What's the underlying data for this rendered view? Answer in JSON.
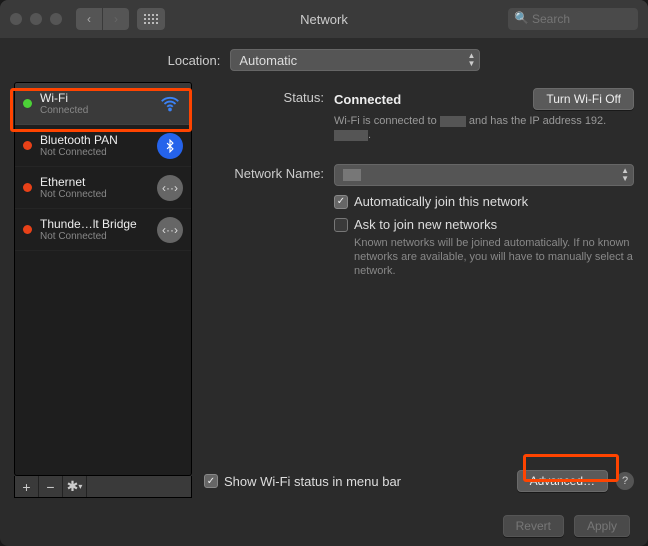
{
  "window": {
    "title": "Network"
  },
  "search": {
    "placeholder": "Search"
  },
  "location": {
    "label": "Location:",
    "value": "Automatic"
  },
  "sidebar": {
    "items": [
      {
        "name": "Wi-Fi",
        "status": "Connected"
      },
      {
        "name": "Bluetooth PAN",
        "status": "Not Connected"
      },
      {
        "name": "Ethernet",
        "status": "Not Connected"
      },
      {
        "name": "Thunde…lt Bridge",
        "status": "Not Connected"
      }
    ]
  },
  "content": {
    "status_label": "Status:",
    "status_value": "Connected",
    "turn_off_label": "Turn Wi-Fi Off",
    "status_detail_a": "Wi-Fi is connected to",
    "status_detail_b": "and has the IP address 192.",
    "netname_label": "Network Name:",
    "netname_value": "",
    "auto_join": "Automatically join this network",
    "ask_join": "Ask to join new networks",
    "ask_help": "Known networks will be joined automatically. If no known networks are available, you will have to manually select a network.",
    "show_menu": "Show Wi-Fi status in menu bar",
    "advanced": "Advanced…"
  },
  "footer": {
    "revert": "Revert",
    "apply": "Apply"
  }
}
